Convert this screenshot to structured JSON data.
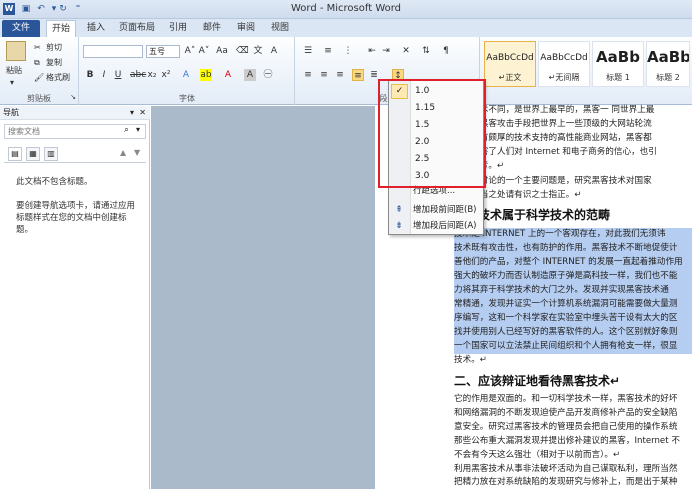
{
  "window": {
    "title": "Word - Microsoft Word"
  },
  "tabs": [
    "文件",
    "开始",
    "插入",
    "页面布局",
    "引用",
    "邮件",
    "审阅",
    "视图"
  ],
  "ribbon": {
    "clipboard": {
      "paste": "粘贴",
      "cut": "剪切",
      "copy": "复制",
      "format_painter": "格式刷",
      "label": "剪贴板"
    },
    "font": {
      "size": "五号",
      "label": "字体"
    },
    "paragraph": {
      "label": "段落"
    },
    "styles": [
      {
        "preview": "AaBbCcDd",
        "name": "↵正文"
      },
      {
        "preview": "AaBbCcDd",
        "name": "↵无间隔"
      },
      {
        "preview": "AaBb",
        "name": "标题 1"
      },
      {
        "preview": "AaBb",
        "name": "标题 2"
      }
    ]
  },
  "nav": {
    "title": "导航",
    "search_placeholder": "搜索文档",
    "empty_line1": "此文档不包含标题。",
    "empty_line2": "要创建导航选项卡，请通过应用标题样式在您的文档中创建标题。"
  },
  "line_spacing_menu": {
    "options": [
      "1.0",
      "1.15",
      "1.5",
      "2.0",
      "2.5",
      "3.0"
    ],
    "selected": "1.0",
    "extra": [
      "行距选项...",
      "增加段前间距(B)",
      "增加段后间距(A)"
    ]
  },
  "document": {
    "para1": [
      "黑客技术不同，是世界上最早的，黑客一 同世界上最",
      "普通的黑客攻击手段把世界上一些顶级的大网站轮流",
      "这样具有颇厚的技术支持的高性能商业网站，黑客都",
      "度上损害了人们对 Internet 和电子商务的信心，也引",
      "术的思考。↵",
      "这里要讨论的一个主要问题是，研究黑客技术对国家",
      "法，不当之处请有识之士指正。↵"
    ],
    "heading1": "黑客技术属于科学技术的范畴",
    "para2_selected": [
      "技术是 INTERNET 上的一个客观存在，对此我们无须讳",
      "技术既有攻击性，也有防护的作用。黑客技术不断地促使计",
      "善他们的产品，对整个 INTERNET 的发展一直起着推动作用",
      "强大的破坏力而否认制造原子弹是高科技一样，我们也不能",
      "力将其弃于科学技术的大门之外。发现并实现黑客技术通",
      "常精通，发现并证实一个计算机系统漏洞可能需要做大量测",
      "序编写，这和一个科学家在实验室中埋头苦干设有太大的区",
      "找并使用别人已经写好的黑客软件的人。这个区别就好象则",
      "一个国家可以立法禁止民间组织和个人拥有枪支一样，很显",
      "技术。↵"
    ],
    "heading2": "二、应该辩证地看待黑客技术↵",
    "para3": [
      "它的作用是双面的。和一切科学技术一样，黑客技术的好坏",
      "和网络漏洞的不断发现迫使产品开发商修补产品的安全缺陷",
      "意安全。研究过黑客技术的管理员会把自己使用的操作系统",
      "那些公布重大漏洞发现并提出修补建议的黑客，Internet 不",
      "不会有今天这么强壮（相对于以前而言）。↵",
      "利用黑客技术从事非法破坏活动为自己谋取私利，理所当然",
      "把精力放在对系统缺陷的发现研究与修补上，而是出于某种"
    ]
  }
}
